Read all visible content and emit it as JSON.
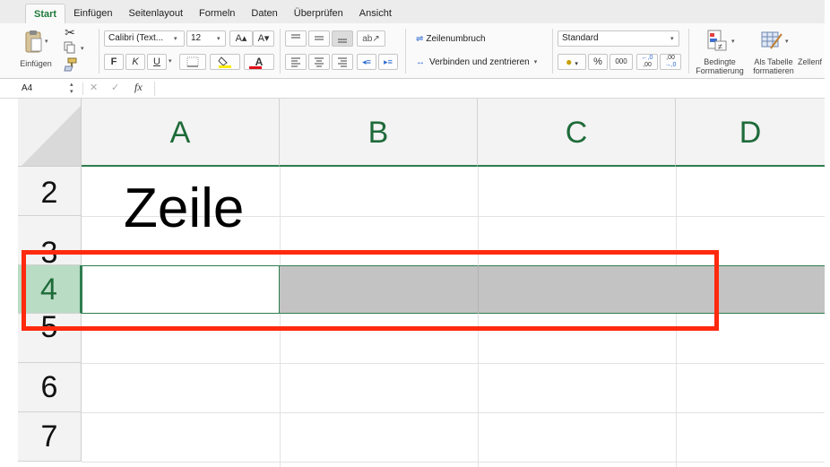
{
  "tabs": [
    "Start",
    "Einfügen",
    "Seitenlayout",
    "Formeln",
    "Daten",
    "Überprüfen",
    "Ansicht"
  ],
  "active_tab": "Start",
  "ribbon": {
    "clipboard": {
      "paste_label": "Einfügen"
    },
    "font": {
      "family": "Calibri (Text...",
      "size": "12",
      "grow": "A▴",
      "shrink": "A▾",
      "bold": "F",
      "italic": "K",
      "underline": "U",
      "font_color_letter": "A"
    },
    "alignment": {
      "wrap_text": "Zeilenumbruch",
      "merge_center": "Verbinden und zentrieren"
    },
    "number": {
      "format": "Standard",
      "percent": "%",
      "thousands": "000",
      "inc_decimal_top": "←,0",
      "inc_decimal_bottom": ",00",
      "dec_decimal_top": ",00",
      "dec_decimal_bottom": "→,0"
    },
    "styles": {
      "conditional_line1": "Bedingte",
      "conditional_line2": "Formatierung",
      "table_line1": "Als Tabelle",
      "table_line2": "formatieren",
      "cell_styles": "Zellenf"
    }
  },
  "formula_bar": {
    "name_box": "A4",
    "cancel": "✕",
    "confirm": "✓",
    "fx": "fx",
    "value": ""
  },
  "grid": {
    "columns": [
      "A",
      "B",
      "C",
      "D"
    ],
    "rows": [
      "2",
      "3",
      "4",
      "5",
      "6",
      "7"
    ],
    "selected_row": "4",
    "cell_text": "Zeile"
  },
  "colors": {
    "accent_green": "#1f6b3a",
    "selection_green": "#b9dcc4",
    "selection_gray": "#c3c3c3",
    "highlight_red": "#ff2a0e"
  }
}
